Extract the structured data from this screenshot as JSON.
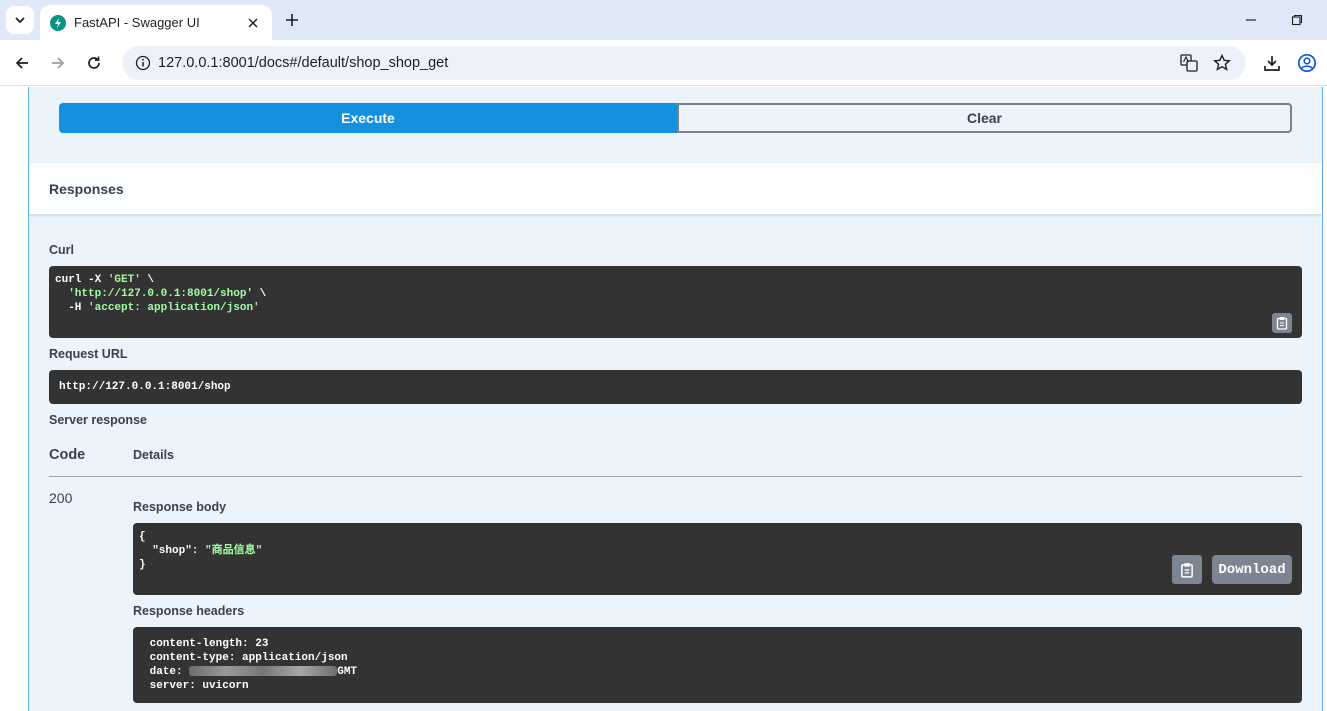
{
  "browser": {
    "tab_title": "FastAPI - Swagger UI",
    "url": "127.0.0.1:8001/docs#/default/shop_shop_get"
  },
  "actions": {
    "execute_label": "Execute",
    "clear_label": "Clear"
  },
  "responses": {
    "title": "Responses",
    "curl_label": "Curl",
    "curl_lines": [
      {
        "cmd": "curl -X ",
        "str": "'GET'",
        "tail": " \\"
      },
      {
        "cmd": "  ",
        "str": "'http://127.0.0.1:8001/shop'",
        "tail": " \\"
      },
      {
        "cmd": "  -H ",
        "str": "'accept: application/json'",
        "tail": ""
      }
    ],
    "request_url_label": "Request URL",
    "request_url": "http://127.0.0.1:8001/shop",
    "server_response_label": "Server response",
    "code_header": "Code",
    "details_header": "Details",
    "status_code": "200",
    "response_body_label": "Response body",
    "response_body": {
      "open": "{",
      "key": "  \"shop\": ",
      "value": "\"商品信息\"",
      "close": "}"
    },
    "download_label": "Download",
    "response_headers_label": "Response headers",
    "headers": {
      "content_length": " content-length: 23",
      "content_type": " content-type: application/json",
      "date_prefix": " date: ",
      "date_suffix": "GMT",
      "server": " server: uvicorn"
    }
  }
}
